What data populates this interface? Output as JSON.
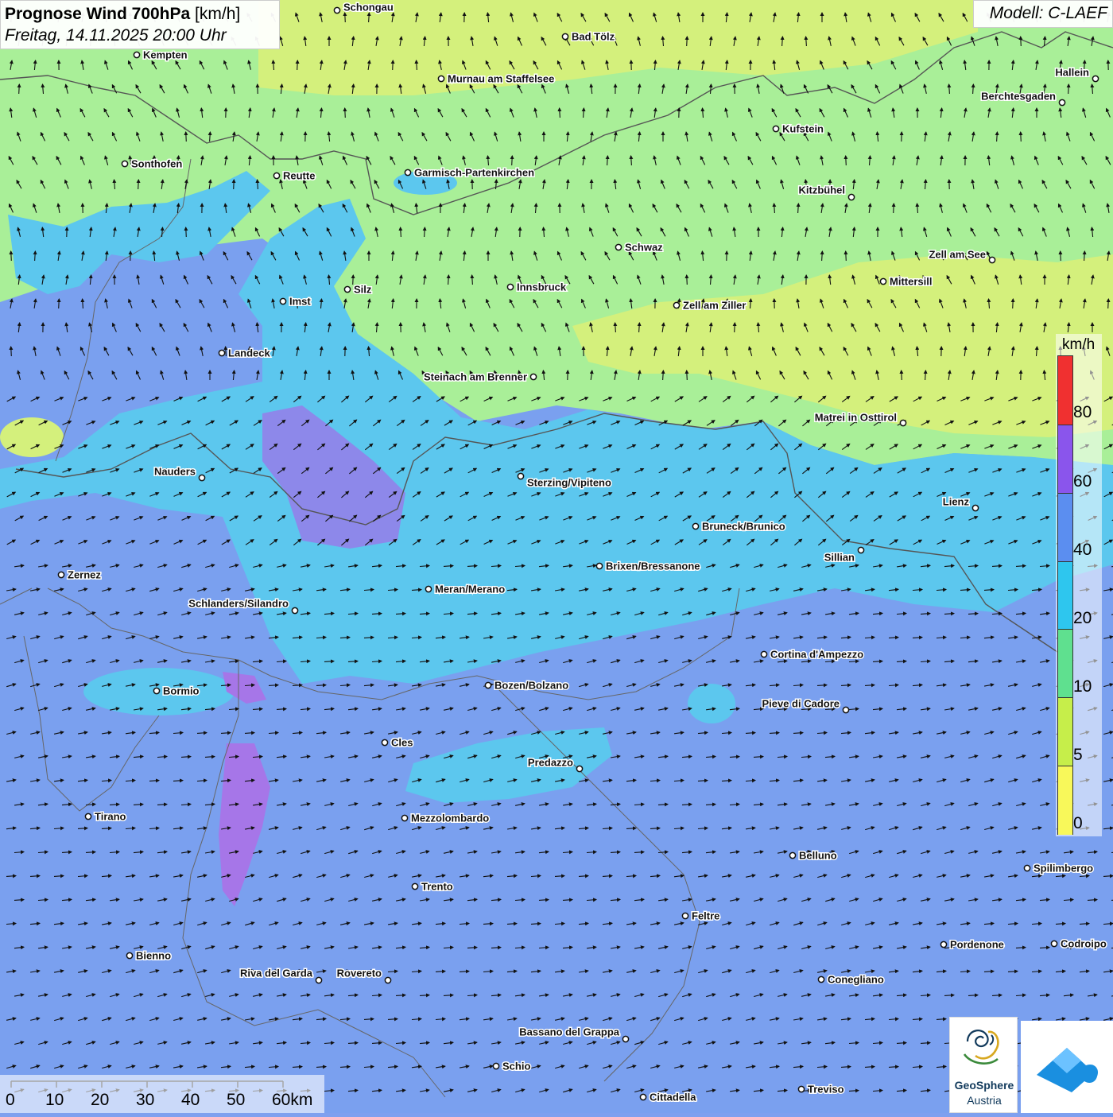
{
  "header": {
    "title": "Prognose Wind 700hPa",
    "unit": "[km/h]",
    "datetime": "Freitag, 14.11.2025 20:00 Uhr"
  },
  "model_label": "Modell: C-LAEF",
  "legend": {
    "unit": "km/h",
    "labels": [
      "80",
      "60",
      "40",
      "20",
      "10",
      "5",
      "0"
    ],
    "colors_top_to_bottom": [
      "#f03030",
      "#8a55ec",
      "#5b8ef0",
      "#2ec6ee",
      "#5fe08f",
      "#c6ee4a",
      "#f8f85a"
    ]
  },
  "map_colors": {
    "low_yellow": "#d6f07f",
    "light_green": "#a9ef98",
    "cyan": "#5cc7ee",
    "blue": "#7aa0ef",
    "purple": "#a07be6"
  },
  "cities": [
    {
      "name": "Schongau"
    },
    {
      "name": "Kempten"
    },
    {
      "name": "Bad Tölz"
    },
    {
      "name": "Murnau am Staffelsee"
    },
    {
      "name": "Hallein"
    },
    {
      "name": "Berchtesgaden"
    },
    {
      "name": "Kufstein"
    },
    {
      "name": "Sonthofen"
    },
    {
      "name": "Reutte"
    },
    {
      "name": "Garmisch-Partenkirchen"
    },
    {
      "name": "Kitzbühel"
    },
    {
      "name": "Schwaz"
    },
    {
      "name": "Zell am See"
    },
    {
      "name": "Mittersill"
    },
    {
      "name": "Innsbruck"
    },
    {
      "name": "Silz"
    },
    {
      "name": "Imst"
    },
    {
      "name": "Zell am Ziller"
    },
    {
      "name": "Landeck"
    },
    {
      "name": "Steinach am Brenner"
    },
    {
      "name": "Matrei in Osttirol"
    },
    {
      "name": "Nauders"
    },
    {
      "name": "Sterzing/Vipiteno"
    },
    {
      "name": "Lienz"
    },
    {
      "name": "Bruneck/Brunico"
    },
    {
      "name": "Sillian"
    },
    {
      "name": "Brixen/Bressanone"
    },
    {
      "name": "Zernez"
    },
    {
      "name": "Meran/Merano"
    },
    {
      "name": "Schlanders/Silandro"
    },
    {
      "name": "Cortina d'Ampezzo"
    },
    {
      "name": "Bozen/Bolzano"
    },
    {
      "name": "Bormio"
    },
    {
      "name": "Pieve di Cadore"
    },
    {
      "name": "Cles"
    },
    {
      "name": "Predazzo"
    },
    {
      "name": "Tirano"
    },
    {
      "name": "Mezzolombardo"
    },
    {
      "name": "Belluno"
    },
    {
      "name": "Spilimbergo"
    },
    {
      "name": "Trento"
    },
    {
      "name": "Feltre"
    },
    {
      "name": "Pordenone"
    },
    {
      "name": "Codroipo"
    },
    {
      "name": "Bienno"
    },
    {
      "name": "Riva del Garda"
    },
    {
      "name": "Rovereto"
    },
    {
      "name": "Conegliano"
    },
    {
      "name": "Bassano del Grappa"
    },
    {
      "name": "Schio"
    },
    {
      "name": "Treviso"
    },
    {
      "name": "Cittadella"
    }
  ],
  "scale_bar": {
    "labels": [
      "0",
      "10",
      "20",
      "30",
      "40",
      "50",
      "60km"
    ]
  },
  "logos": {
    "geosphere_name": "GeoSphere",
    "geosphere_sub": "Austria"
  }
}
